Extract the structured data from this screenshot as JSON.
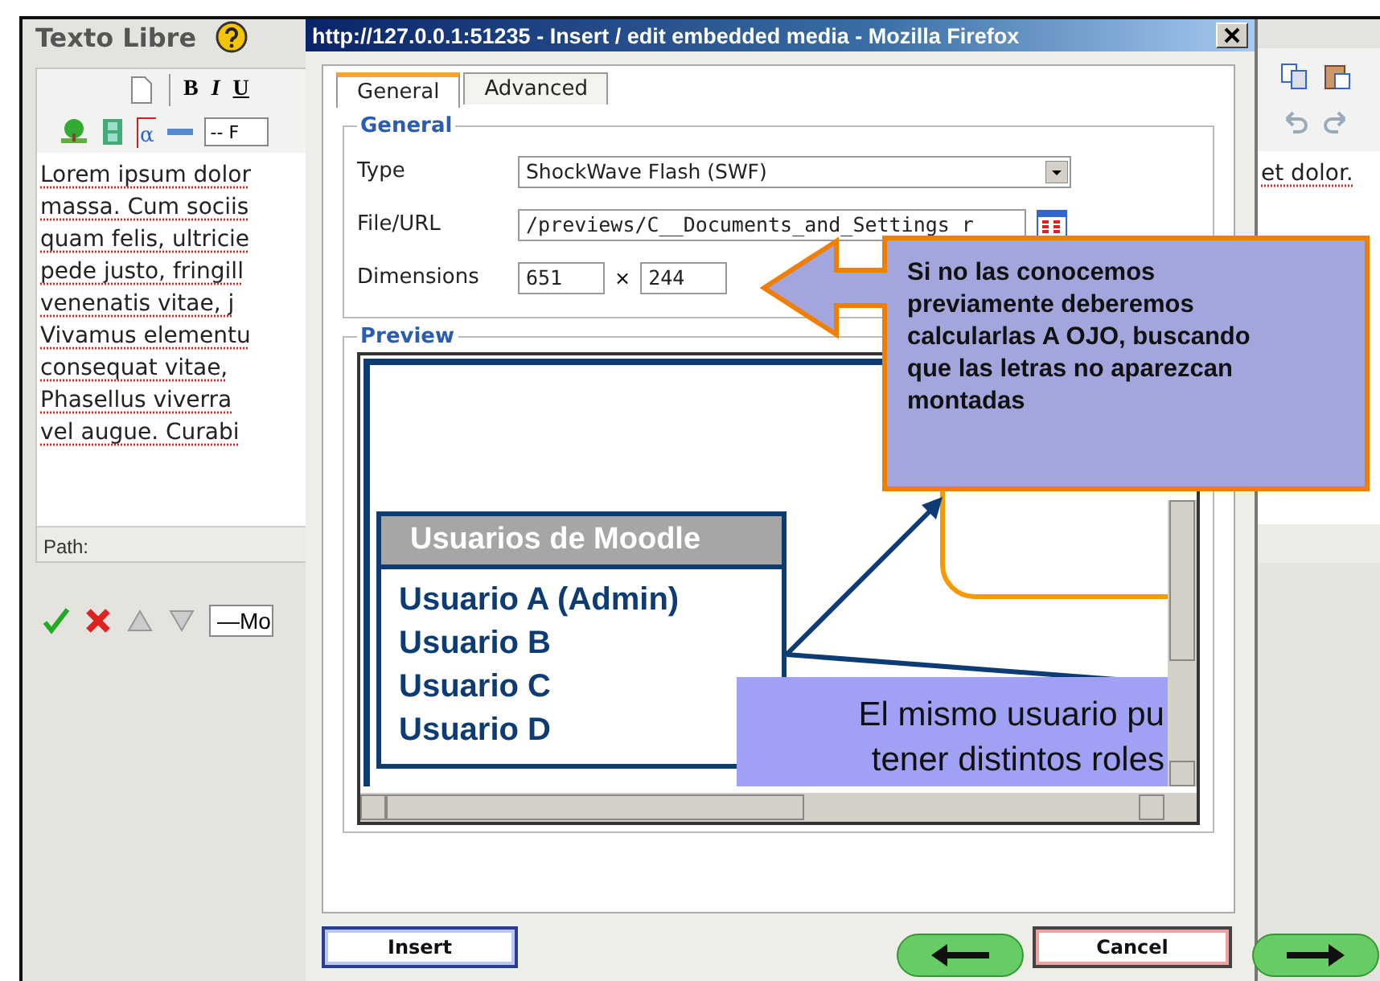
{
  "editor": {
    "title": "Texto Libre",
    "toolbar_letters": [
      "B",
      "I",
      "U"
    ],
    "formula_symbol": "α",
    "format_select": "-- F",
    "text_lines": [
      "Lorem ipsum dolor",
      "massa. Cum sociis",
      "quam felis, ultricie",
      "pede justo, fringill",
      "venenatis vitae, j",
      "Vivamus elementu",
      "consequat vitae,",
      "Phasellus viverra",
      "vel augue. Curabi"
    ],
    "path_label": "Path:",
    "style_select": "—Mo"
  },
  "right_editor": {
    "text_lines": [
      "et dolor."
    ]
  },
  "dialog": {
    "title": "http://127.0.0.1:51235 - Insert / edit embedded media - Mozilla Firefox",
    "tabs": [
      {
        "label": "General",
        "selected": true
      },
      {
        "label": "Advanced",
        "selected": false
      }
    ],
    "general_legend": "General",
    "fields": [
      {
        "kind": "select",
        "label": "Type",
        "value": "ShockWave Flash (SWF)"
      },
      {
        "kind": "browse",
        "label": "File/URL",
        "value": "/previews/C__Documents_and_Settings_r"
      },
      {
        "kind": "dimensions",
        "label": "Dimensions",
        "value": "651",
        "separator": "×",
        "value2": "244"
      }
    ],
    "preview_legend": "Preview",
    "slide": {
      "header": "Usuarios de Moodle",
      "users": [
        "Usuario A (Admin)",
        "Usuario B",
        "Usuario C",
        "Usuario D"
      ],
      "bubble_lines": [
        "El mismo usuario pu",
        "tener distintos roles"
      ]
    },
    "insert_button": "Insert",
    "cancel_button": "Cancel"
  },
  "callout": {
    "text": "Si no las conocemos previamente deberemos calcularlas A OJO, buscando que las letras no aparezcan montadas"
  }
}
